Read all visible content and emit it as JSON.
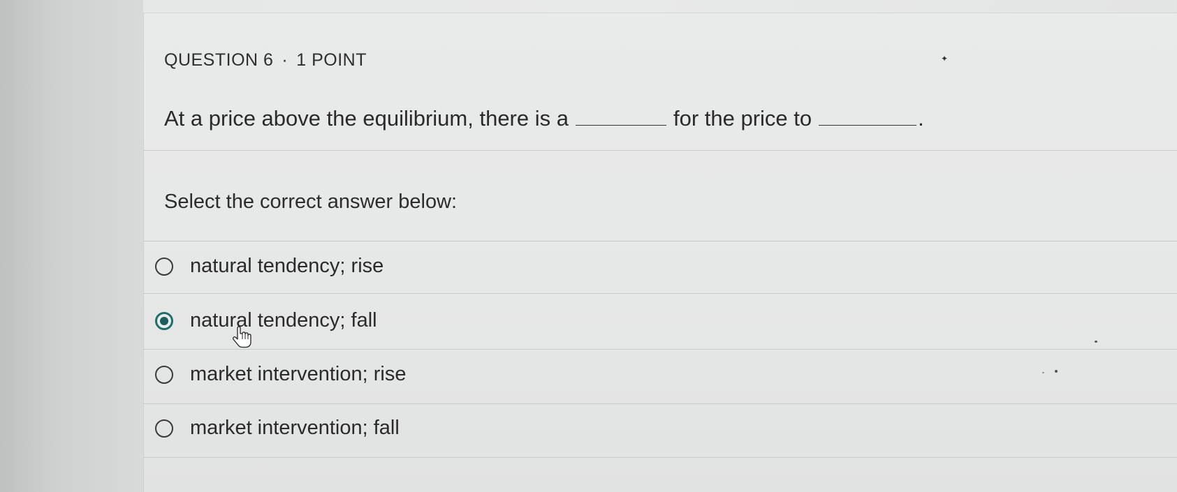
{
  "question": {
    "number_label": "QUESTION 6",
    "separator": "·",
    "points_label": "1 POINT",
    "prompt_part1": "At a price above the equilibrium, there is a",
    "prompt_part2": "for the price to",
    "prompt_end": "."
  },
  "instruction": "Select the correct answer below:",
  "options": [
    {
      "label": "natural tendency; rise",
      "selected": false
    },
    {
      "label": "natural tendency; fall",
      "selected": true
    },
    {
      "label": "market intervention; rise",
      "selected": false
    },
    {
      "label": "market intervention; fall",
      "selected": false
    }
  ],
  "colors": {
    "selected_radio": "#1a5f5b",
    "text": "#2a2a2a",
    "card_bg": "#e8e9e9"
  },
  "icons": {
    "cursor": "hand-pointer-icon",
    "flag": "bookmark-icon"
  }
}
